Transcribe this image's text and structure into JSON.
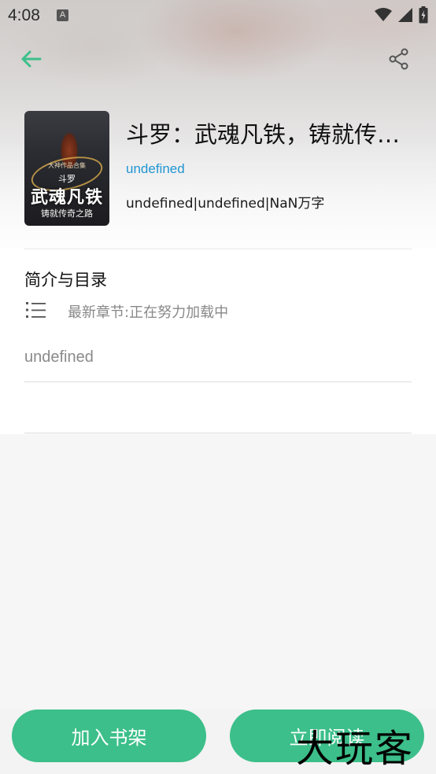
{
  "status_bar": {
    "time": "4:08",
    "notification_letter": "A",
    "icons": [
      "wifi-icon",
      "signal-icon",
      "battery-icon"
    ]
  },
  "toolbar": {
    "back_icon": "arrow-left-icon",
    "share_icon": "share-icon",
    "accent_color": "#3cbf8a"
  },
  "book": {
    "cover": {
      "top_small": "大神作品合集",
      "series": "斗罗",
      "title": "武魂凡铁",
      "subtitle": "铸就传奇之路"
    },
    "title": "斗罗：武魂凡铁，铸就传…",
    "author": "undefined",
    "meta": "undefined|undefined|NaN万字"
  },
  "section": {
    "title": "简介与目录",
    "toc_icon": "list-icon",
    "latest_chapter": "最新章节:正在努力加载中",
    "intro": "undefined"
  },
  "actions": {
    "add_to_shelf": "加入书架",
    "read_now": "立即阅读",
    "button_color": "#3cbf8a"
  },
  "watermark": "大玩客"
}
